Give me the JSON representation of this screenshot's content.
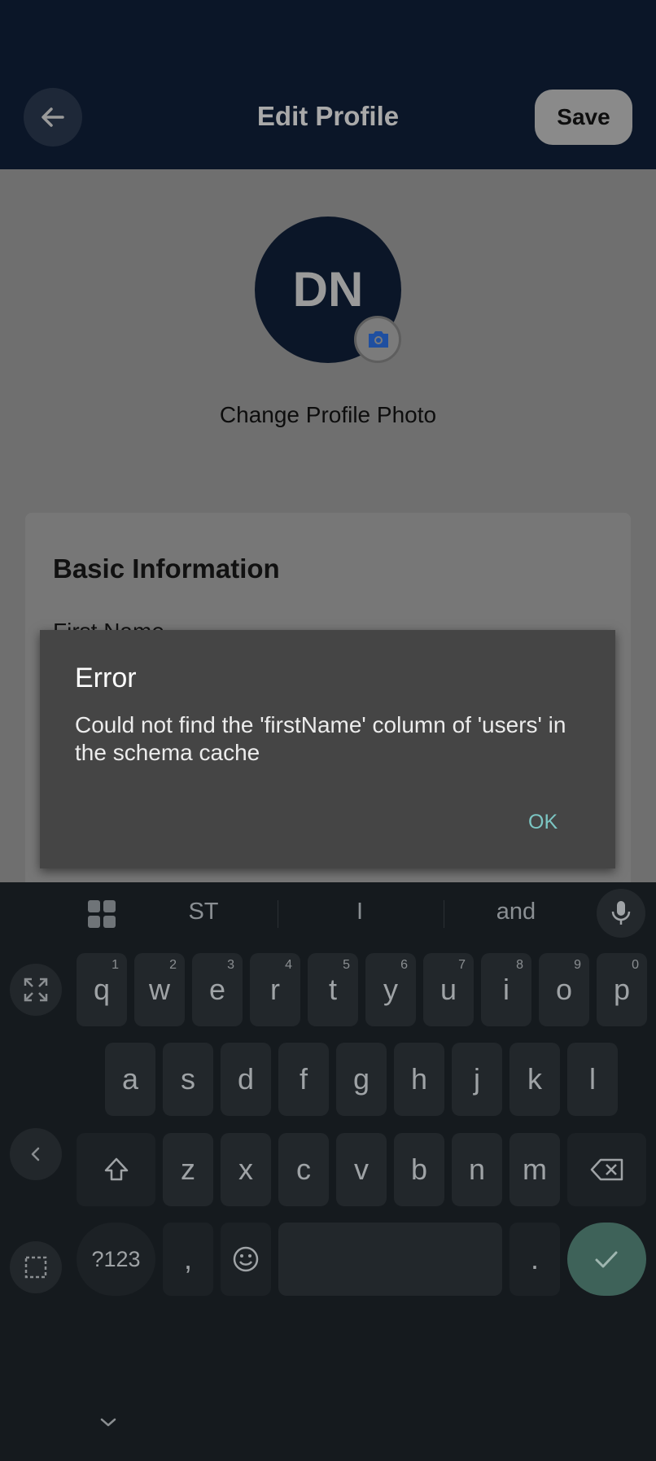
{
  "header": {
    "title": "Edit Profile",
    "save_label": "Save"
  },
  "profile": {
    "initials": "DN",
    "change_photo_label": "Change Profile Photo"
  },
  "card": {
    "title": "Basic Information",
    "first_name_label": "First Name"
  },
  "dialog": {
    "title": "Error",
    "message": "Could not find the 'firstName' column of 'users' in the schema cache",
    "ok_label": "OK"
  },
  "keyboard": {
    "suggestions": [
      "ST",
      "I",
      "and"
    ],
    "row1": [
      {
        "key": "q",
        "hint": "1"
      },
      {
        "key": "w",
        "hint": "2"
      },
      {
        "key": "e",
        "hint": "3"
      },
      {
        "key": "r",
        "hint": "4"
      },
      {
        "key": "t",
        "hint": "5"
      },
      {
        "key": "y",
        "hint": "6"
      },
      {
        "key": "u",
        "hint": "7"
      },
      {
        "key": "i",
        "hint": "8"
      },
      {
        "key": "o",
        "hint": "9"
      },
      {
        "key": "p",
        "hint": "0"
      }
    ],
    "row2": [
      "a",
      "s",
      "d",
      "f",
      "g",
      "h",
      "j",
      "k",
      "l"
    ],
    "row3": [
      "z",
      "x",
      "c",
      "v",
      "b",
      "n",
      "m"
    ],
    "symbols_label": "?123",
    "comma_label": ",",
    "period_label": "."
  }
}
